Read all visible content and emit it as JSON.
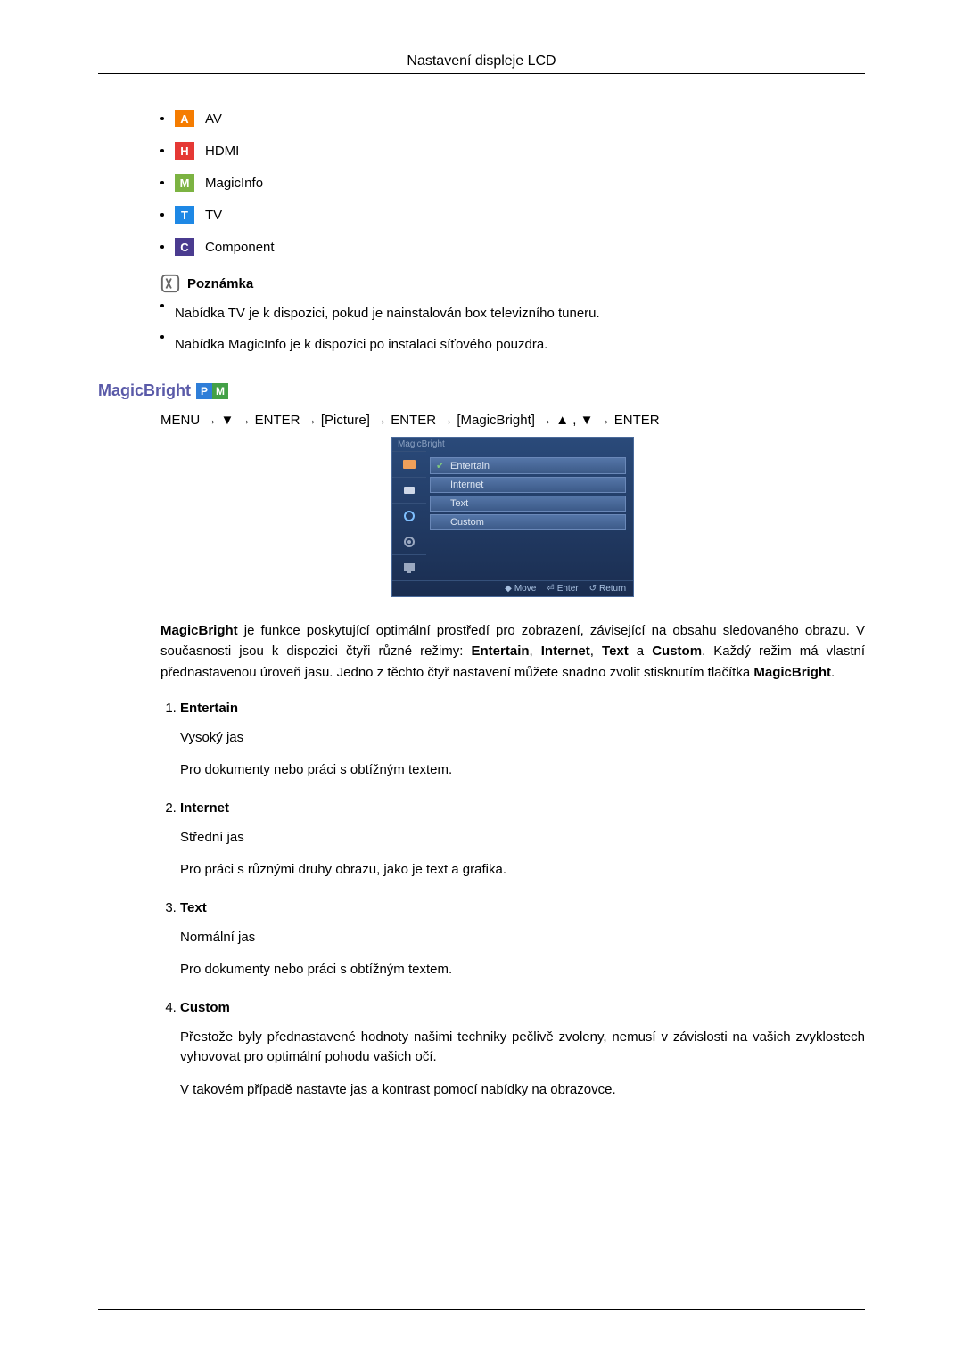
{
  "header": {
    "title": "Nastavení displeje LCD"
  },
  "sources": [
    {
      "letter": "A",
      "label": "AV",
      "cls": "badge-a"
    },
    {
      "letter": "H",
      "label": "HDMI",
      "cls": "badge-h"
    },
    {
      "letter": "M",
      "label": "MagicInfo",
      "cls": "badge-m"
    },
    {
      "letter": "T",
      "label": "TV",
      "cls": "badge-t"
    },
    {
      "letter": "C",
      "label": "Component",
      "cls": "badge-c"
    }
  ],
  "note": {
    "title": "Poznámka",
    "items": [
      "Nabídka TV je k dispozici, pokud je nainstalován box televizního tuneru.",
      "Nabídka MagicInfo je k dispozici po instalaci síťového pouzdra."
    ]
  },
  "section": {
    "title": "MagicBright",
    "pm_p": "P",
    "pm_m": "M",
    "menu_path": "MENU → ▼ → ENTER → [Picture] → ENTER → [MagicBright] → ▲ , ▼ → ENTER"
  },
  "osd": {
    "title": "MagicBright",
    "items": [
      {
        "label": "Entertain",
        "checked": true
      },
      {
        "label": "Internet",
        "checked": false
      },
      {
        "label": "Text",
        "checked": false
      },
      {
        "label": "Custom",
        "checked": false
      }
    ],
    "footer": {
      "move": "Move",
      "enter": "Enter",
      "ret": "Return"
    }
  },
  "description": {
    "pre": "MagicBright",
    "t1": " je funkce poskytující optimální prostředí pro zobrazení, závisející na obsahu sledovaného obrazu. V současnosti jsou k dispozici čtyři různé režimy: ",
    "m1": "Entertain",
    "c1": ", ",
    "m2": "Internet",
    "c2": ", ",
    "m3": "Text",
    "t2": " a ",
    "m4": "Custom",
    "t3": ". Každý režim má vlastní přednastavenou úroveň jasu. Jedno z těchto čtyř nastavení můžete snadno zvolit stisknutím tlačítka ",
    "m5": "MagicBright",
    "t4": "."
  },
  "modes": [
    {
      "name": "Entertain",
      "lines": [
        "Vysoký jas",
        "Pro dokumenty nebo práci s obtížným textem."
      ]
    },
    {
      "name": "Internet",
      "lines": [
        "Střední jas",
        "Pro práci s různými druhy obrazu, jako je text a grafika."
      ]
    },
    {
      "name": "Text",
      "lines": [
        "Normální jas",
        "Pro dokumenty nebo práci s obtížným textem."
      ]
    },
    {
      "name": "Custom",
      "lines": [
        "Přestože byly přednastavené hodnoty našimi techniky pečlivě zvoleny, nemusí v závislosti na vašich zvyklostech vyhovovat pro optimální pohodu vašich očí.",
        "V takovém případě nastavte jas a kontrast pomocí nabídky na obrazovce."
      ]
    }
  ]
}
